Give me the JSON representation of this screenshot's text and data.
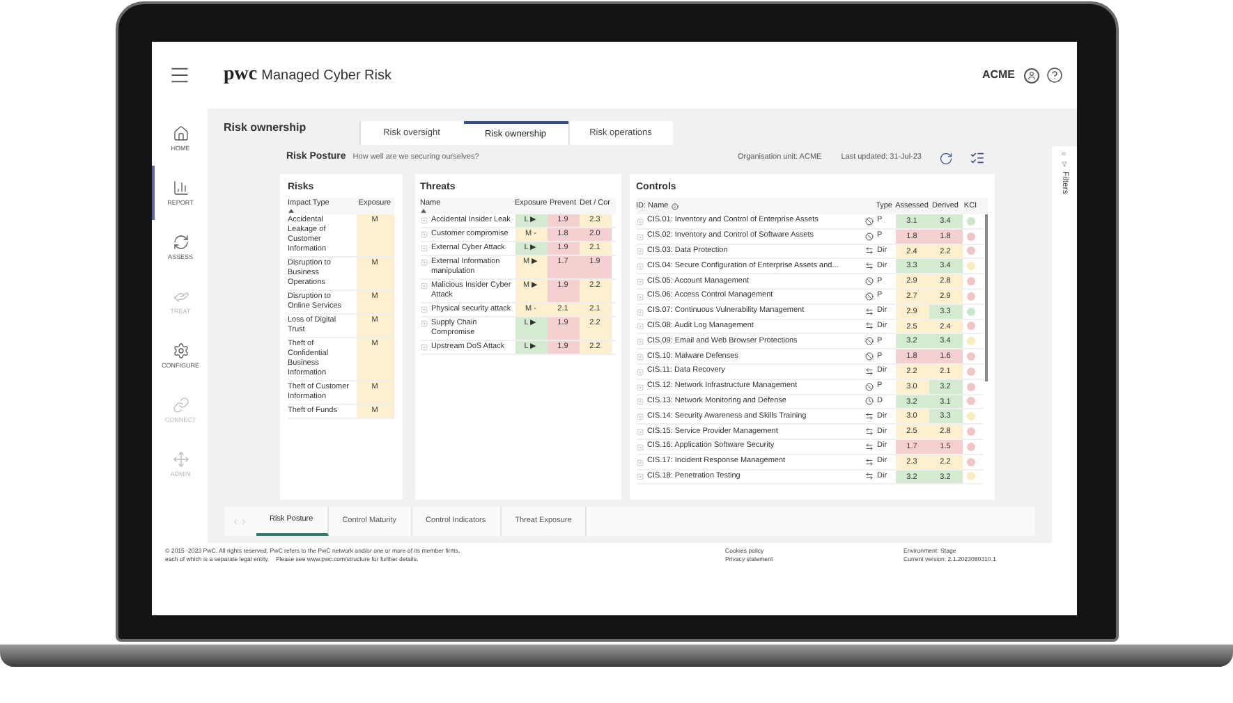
{
  "header": {
    "logo": "pwc",
    "app_name": "Managed Cyber Risk",
    "organisation": "ACME"
  },
  "sidebar": {
    "items": [
      {
        "label": "HOME",
        "kind": "home",
        "selected": false,
        "disabled": false
      },
      {
        "label": "REPORT",
        "kind": "report",
        "selected": true,
        "disabled": false
      },
      {
        "label": "ASSESS",
        "kind": "assess",
        "selected": false,
        "disabled": false
      },
      {
        "label": "TREAT",
        "kind": "treat",
        "selected": false,
        "disabled": true
      },
      {
        "label": "CONFIGURE",
        "kind": "configure",
        "selected": false,
        "disabled": false
      },
      {
        "label": "CONNECT",
        "kind": "connect",
        "selected": false,
        "disabled": true
      },
      {
        "label": "ADMIN",
        "kind": "admin",
        "selected": false,
        "disabled": true
      }
    ]
  },
  "page_title": "Risk ownership",
  "tabs": [
    {
      "label": "Risk oversight",
      "selected": false
    },
    {
      "label": "Risk ownership",
      "selected": true
    },
    {
      "label": "Risk operations",
      "selected": false
    }
  ],
  "posture": {
    "title": "Risk Posture",
    "subtitle": "How well are we securing ourselves?",
    "organisation_unit": "Organisation unit: ACME",
    "last_updated": "Last updated: 31-Jul-23"
  },
  "risks": {
    "title": "Risks",
    "columns": [
      "Impact Type",
      "Exposure"
    ],
    "rows": [
      {
        "impact_type": "Accidental Leakage of Customer Information",
        "exposure": {
          "value": "M",
          "color": "#fdf0cf"
        }
      },
      {
        "impact_type": "Disruption to Business Operations",
        "exposure": {
          "value": "M",
          "color": "#fdf0cf"
        }
      },
      {
        "impact_type": "Disruption to Online Services",
        "exposure": {
          "value": "M",
          "color": "#fdf0cf"
        }
      },
      {
        "impact_type": "Loss of Digital Trust",
        "exposure": {
          "value": "M",
          "color": "#fdf0cf"
        }
      },
      {
        "impact_type": "Theft of Confidential Business Information",
        "exposure": {
          "value": "M",
          "color": "#fdf0cf"
        }
      },
      {
        "impact_type": "Theft of Customer Information",
        "exposure": {
          "value": "M",
          "color": "#fdf0cf"
        }
      },
      {
        "impact_type": "Theft of Funds",
        "exposure": {
          "value": "M",
          "color": "#fdf0cf"
        }
      }
    ]
  },
  "threats": {
    "title": "Threats",
    "columns": [
      "Name",
      "Exposure",
      "Prevent",
      "Det / Cor"
    ],
    "rows": [
      {
        "name": "Accidental Insider Leak",
        "exposure": {
          "value": "L ▶",
          "color": "#d4ebd2"
        },
        "prevent": {
          "value": "1.9",
          "color": "#f5d0d0"
        },
        "det_cor": {
          "value": "2.3",
          "color": "#fdf0cf"
        }
      },
      {
        "name": "Customer compromise",
        "exposure": {
          "value": "M -",
          "color": "#fdf0cf"
        },
        "prevent": {
          "value": "1.8",
          "color": "#f5d0d0"
        },
        "det_cor": {
          "value": "2.0",
          "color": "#f5d0d0"
        }
      },
      {
        "name": "External Cyber Attack",
        "exposure": {
          "value": "L ▶",
          "color": "#d4ebd2"
        },
        "prevent": {
          "value": "1.9",
          "color": "#f5d0d0"
        },
        "det_cor": {
          "value": "2.1",
          "color": "#fdf0cf"
        }
      },
      {
        "name": "External Information manipulation",
        "exposure": {
          "value": "M ▶",
          "color": "#fdf0cf"
        },
        "prevent": {
          "value": "1.7",
          "color": "#f5d0d0"
        },
        "det_cor": {
          "value": "1.9",
          "color": "#f5d0d0"
        }
      },
      {
        "name": "Malicious Insider Cyber Attack",
        "exposure": {
          "value": "M ▶",
          "color": "#fdf0cf"
        },
        "prevent": {
          "value": "1.9",
          "color": "#f5d0d0"
        },
        "det_cor": {
          "value": "2.2",
          "color": "#fdf0cf"
        }
      },
      {
        "name": "Physical security attack",
        "exposure": {
          "value": "M -",
          "color": "#fdf0cf"
        },
        "prevent": {
          "value": "2.1",
          "color": "#fdf0cf"
        },
        "det_cor": {
          "value": "2.1",
          "color": "#fdf0cf"
        }
      },
      {
        "name": "Supply Chain Compromise",
        "exposure": {
          "value": "L ▶",
          "color": "#d4ebd2"
        },
        "prevent": {
          "value": "1.9",
          "color": "#f5d0d0"
        },
        "det_cor": {
          "value": "2.2",
          "color": "#fdf0cf"
        }
      },
      {
        "name": "Upstream DoS Attack",
        "exposure": {
          "value": "L ▶",
          "color": "#d4ebd2"
        },
        "prevent": {
          "value": "1.9",
          "color": "#f5d0d0"
        },
        "det_cor": {
          "value": "2.2",
          "color": "#fdf0cf"
        }
      }
    ]
  },
  "controls": {
    "title": "Controls",
    "columns": [
      "ID: Name",
      "Type",
      "Assessed",
      "Derived",
      "KCI"
    ],
    "rows": [
      {
        "id_name": "CIS.01: Inventory and Control of Enterprise Assets",
        "kind": "preventive",
        "type": "P",
        "assessed": {
          "value": "3.1",
          "color": "#d4ebd2"
        },
        "derived": {
          "value": "3.4",
          "color": "#d4ebd2"
        },
        "kci": {
          "color": "#c9e7c6"
        }
      },
      {
        "id_name": "CIS.02: Inventory and Control of Software Assets",
        "kind": "preventive",
        "type": "P",
        "assessed": {
          "value": "1.8",
          "color": "#f5d0d0"
        },
        "derived": {
          "value": "1.8",
          "color": "#f5d0d0"
        },
        "kci": {
          "color": "#f2c4c4"
        }
      },
      {
        "id_name": "CIS.03: Data Protection",
        "kind": "directive",
        "type": "Dir",
        "assessed": {
          "value": "2.4",
          "color": "#fdf0cf"
        },
        "derived": {
          "value": "2.2",
          "color": "#fdf0cf"
        },
        "kci": {
          "color": "#f2c4c4"
        }
      },
      {
        "id_name": "CIS.04: Secure Configuration of Enterprise Assets and...",
        "kind": "directive",
        "type": "Dir",
        "assessed": {
          "value": "3.3",
          "color": "#d4ebd2"
        },
        "derived": {
          "value": "3.4",
          "color": "#d4ebd2"
        },
        "kci": {
          "color": "#fbebbd"
        }
      },
      {
        "id_name": "CIS.05: Account Management",
        "kind": "preventive",
        "type": "P",
        "assessed": {
          "value": "2.9",
          "color": "#fdf0cf"
        },
        "derived": {
          "value": "2.8",
          "color": "#fdf0cf"
        },
        "kci": {
          "color": "#f2c4c4"
        }
      },
      {
        "id_name": "CIS.06: Access Control Management",
        "kind": "preventive",
        "type": "P",
        "assessed": {
          "value": "2.7",
          "color": "#fdf0cf"
        },
        "derived": {
          "value": "2.9",
          "color": "#fdf0cf"
        },
        "kci": {
          "color": "#f2c4c4"
        }
      },
      {
        "id_name": "CIS.07: Continuous Vulnerability Management",
        "kind": "directive",
        "type": "Dir",
        "assessed": {
          "value": "2.9",
          "color": "#fdf0cf"
        },
        "derived": {
          "value": "3.3",
          "color": "#d4ebd2"
        },
        "kci": {
          "color": "#c9e7c6"
        }
      },
      {
        "id_name": "CIS.08: Audit Log Management",
        "kind": "directive",
        "type": "Dir",
        "assessed": {
          "value": "2.5",
          "color": "#fdf0cf"
        },
        "derived": {
          "value": "2.4",
          "color": "#fdf0cf"
        },
        "kci": {
          "color": "#f2c4c4"
        }
      },
      {
        "id_name": "CIS.09: Email and Web Browser Protections",
        "kind": "preventive",
        "type": "P",
        "assessed": {
          "value": "3.2",
          "color": "#d4ebd2"
        },
        "derived": {
          "value": "3.4",
          "color": "#d4ebd2"
        },
        "kci": {
          "color": "#fbebbd"
        }
      },
      {
        "id_name": "CIS.10: Malware Defenses",
        "kind": "preventive",
        "type": "P",
        "assessed": {
          "value": "1.8",
          "color": "#f5d0d0"
        },
        "derived": {
          "value": "1.6",
          "color": "#f5d0d0"
        },
        "kci": {
          "color": "#f2c4c4"
        }
      },
      {
        "id_name": "CIS.11: Data Recovery",
        "kind": "directive",
        "type": "Dir",
        "assessed": {
          "value": "2.2",
          "color": "#fdf0cf"
        },
        "derived": {
          "value": "2.1",
          "color": "#fdf0cf"
        },
        "kci": {
          "color": "#f2c4c4"
        }
      },
      {
        "id_name": "CIS.12: Network Infrastructure Management",
        "kind": "preventive",
        "type": "P",
        "assessed": {
          "value": "3.0",
          "color": "#fdf0cf"
        },
        "derived": {
          "value": "3.2",
          "color": "#d4ebd2"
        },
        "kci": {
          "color": "#f2c4c4"
        }
      },
      {
        "id_name": "CIS.13: Network Monitoring and Defense",
        "kind": "detective",
        "type": "D",
        "assessed": {
          "value": "3.2",
          "color": "#d4ebd2"
        },
        "derived": {
          "value": "3.1",
          "color": "#d4ebd2"
        },
        "kci": {
          "color": "#f2c4c4"
        }
      },
      {
        "id_name": "CIS.14: Security Awareness and Skills Training",
        "kind": "directive",
        "type": "Dir",
        "assessed": {
          "value": "3.0",
          "color": "#fdf0cf"
        },
        "derived": {
          "value": "3.3",
          "color": "#d4ebd2"
        },
        "kci": {
          "color": "#fbebbd"
        }
      },
      {
        "id_name": "CIS.15: Service Provider Management",
        "kind": "directive",
        "type": "Dir",
        "assessed": {
          "value": "2.5",
          "color": "#fdf0cf"
        },
        "derived": {
          "value": "2.8",
          "color": "#fdf0cf"
        },
        "kci": {
          "color": "#f2c4c4"
        }
      },
      {
        "id_name": "CIS.16: Application Software Security",
        "kind": "directive",
        "type": "Dir",
        "assessed": {
          "value": "1.7",
          "color": "#f5d0d0"
        },
        "derived": {
          "value": "1.5",
          "color": "#f5d0d0"
        },
        "kci": {
          "color": "#f2c4c4"
        }
      },
      {
        "id_name": "CIS.17: Incident Response Management",
        "kind": "directive",
        "type": "Dir",
        "assessed": {
          "value": "2.3",
          "color": "#fdf0cf"
        },
        "derived": {
          "value": "2.2",
          "color": "#fdf0cf"
        },
        "kci": {
          "color": "#f2c4c4"
        }
      },
      {
        "id_name": "CIS.18: Penetration Testing",
        "kind": "directive",
        "type": "Dir",
        "assessed": {
          "value": "3.2",
          "color": "#d4ebd2"
        },
        "derived": {
          "value": "3.2",
          "color": "#d4ebd2"
        },
        "kci": {
          "color": "#fbebbd"
        }
      }
    ]
  },
  "filters": {
    "label": "Filters"
  },
  "bottom_tabs": [
    {
      "label": "Risk Posture",
      "selected": true
    },
    {
      "label": "Control Maturity",
      "selected": false
    },
    {
      "label": "Control Indicators",
      "selected": false
    },
    {
      "label": "Threat Exposure",
      "selected": false
    }
  ],
  "footer": {
    "copyright_lines": [
      "© 2015 -2023 PwC. All rights reserved. PwC refers to the PwC network and/or one or more of its member firms,",
      "each of which is a separate legal entity.    Please see www.pwc.com/structure for further details."
    ],
    "links": [
      "Cookies policy",
      "Privacy statement"
    ],
    "environment": "Environment: Stage",
    "version": "Current version: 2.1.2023080310.1"
  }
}
